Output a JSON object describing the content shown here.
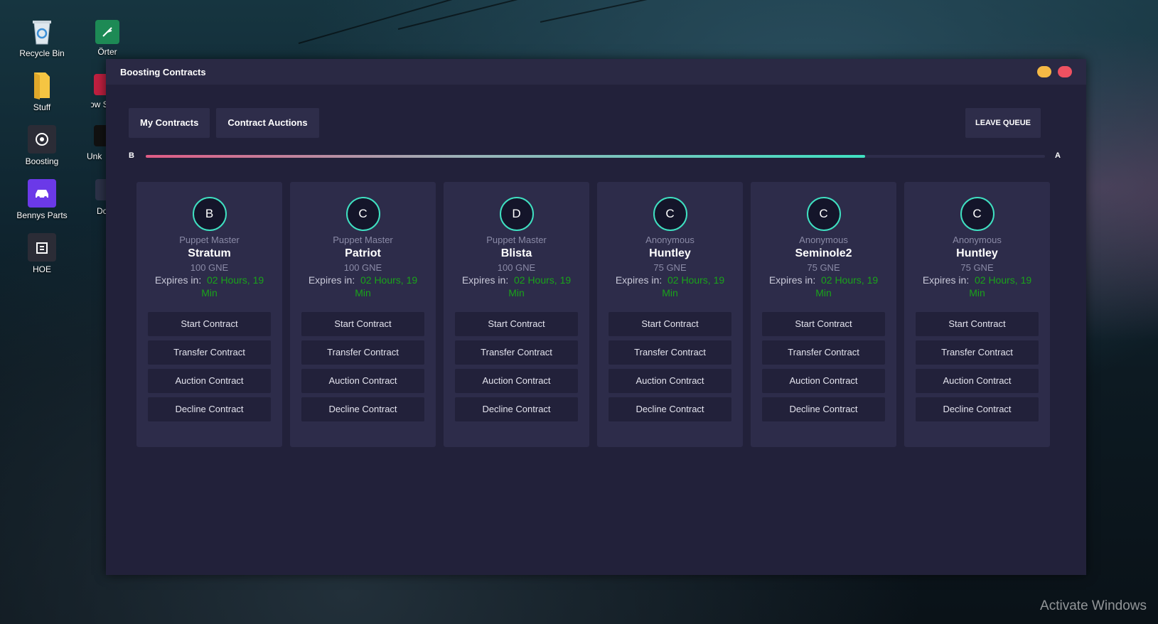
{
  "desktop": {
    "icons": [
      {
        "label": "Recycle Bin",
        "icon": "recycle-bin-icon"
      },
      {
        "label": "Stuff",
        "icon": "folder-icon"
      },
      {
        "label": "Boosting",
        "icon": "boosting-icon"
      },
      {
        "label": "Bennys Parts",
        "icon": "car-icon"
      },
      {
        "label": "HOE",
        "icon": "building-icon"
      },
      {
        "label": "Örter",
        "icon": "plant-icon"
      },
      {
        "label": "Tow S",
        "icon": "tow-truck-icon"
      },
      {
        "label": "Unk",
        "icon": "shield-icon"
      },
      {
        "label": "Do",
        "icon": "pin-icon"
      }
    ],
    "watermark": "Activate Windows"
  },
  "app": {
    "title": "Boosting Contracts",
    "tabs": [
      "My Contracts",
      "Contract Auctions"
    ],
    "leave_queue": "LEAVE QUEUE",
    "progress": {
      "from": "B",
      "to": "A",
      "fraction": 0.8
    },
    "expires_label": "Expires in:",
    "contracts": [
      {
        "class": "B",
        "owner": "Puppet Master",
        "vehicle": "Stratum",
        "price": "100 GNE",
        "expires": "02 Hours, 19 Min"
      },
      {
        "class": "C",
        "owner": "Puppet Master",
        "vehicle": "Patriot",
        "price": "100 GNE",
        "expires": "02 Hours, 19 Min"
      },
      {
        "class": "D",
        "owner": "Puppet Master",
        "vehicle": "Blista",
        "price": "100 GNE",
        "expires": "02 Hours, 19 Min"
      },
      {
        "class": "C",
        "owner": "Anonymous",
        "vehicle": "Huntley",
        "price": "75 GNE",
        "expires": "02 Hours, 19 Min"
      },
      {
        "class": "C",
        "owner": "Anonymous",
        "vehicle": "Seminole2",
        "price": "75 GNE",
        "expires": "02 Hours, 19 Min"
      },
      {
        "class": "C",
        "owner": "Anonymous",
        "vehicle": "Huntley",
        "price": "75 GNE",
        "expires": "02 Hours, 19 Min"
      }
    ],
    "actions": [
      "Start Contract",
      "Transfer Contract",
      "Auction Contract",
      "Decline Contract"
    ],
    "colors": {
      "accent": "#3fe0c1",
      "pink": "#e05b85",
      "minimize": "#f5b945",
      "close": "#ef5161",
      "expires": "#1aa31a"
    }
  }
}
